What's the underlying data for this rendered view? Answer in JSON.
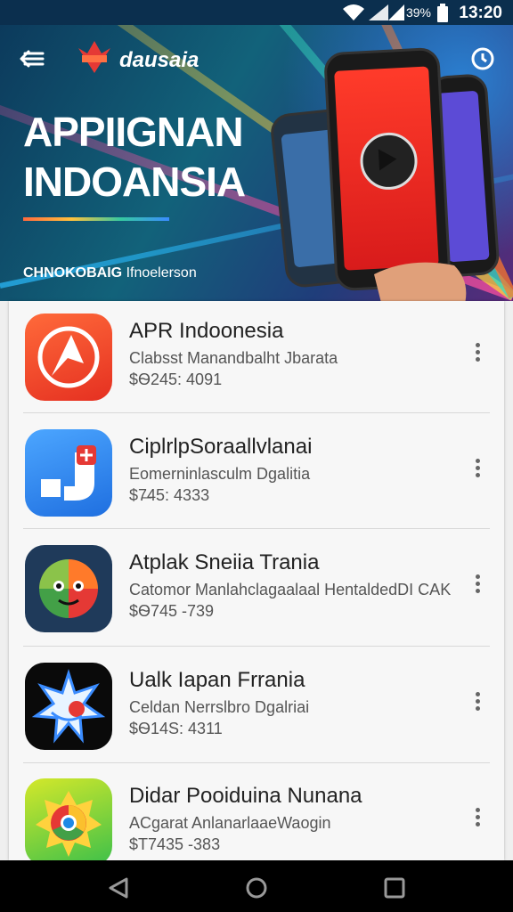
{
  "status_bar": {
    "battery": "39%",
    "time": "13:20"
  },
  "header": {
    "brand": "dausaia",
    "title_line1": "APPIIGNAN",
    "title_line2": "INDOANSIA",
    "tagline_bold": "CHNOKOBAIG",
    "tagline_rest": "Ifnoelerson"
  },
  "apps": [
    {
      "name": "APR Indoonesia",
      "subtitle": "Clabsst Manandbalht Jbarata",
      "price": "$Ѳ245: 4091"
    },
    {
      "name": "CiplrlpSoraallvlanai",
      "subtitle": "Eomerninlasculm Dgalitia",
      "price": "$7̶45: 4333"
    },
    {
      "name": "Atplak Sneiia Trania",
      "subtitle": "Catomor Manlahclagaalaal HentaldedDI CAK",
      "price": "$Ѳ745 -739"
    },
    {
      "name": "Ualk Iapan Frrania",
      "subtitle": "Celdan Nerrslbro Dgalriai",
      "price": "$Ѳ14S: 4311"
    },
    {
      "name": "Didar Pooiduina Nunana",
      "subtitle": "ACgarat AnlanarlaaeWaogin",
      "price": "$T7435 -383"
    }
  ],
  "colors": {
    "status_bar": "#0b2f4e",
    "accent_orange": "#ff5a2a",
    "list_bg": "#f7f7f7"
  }
}
